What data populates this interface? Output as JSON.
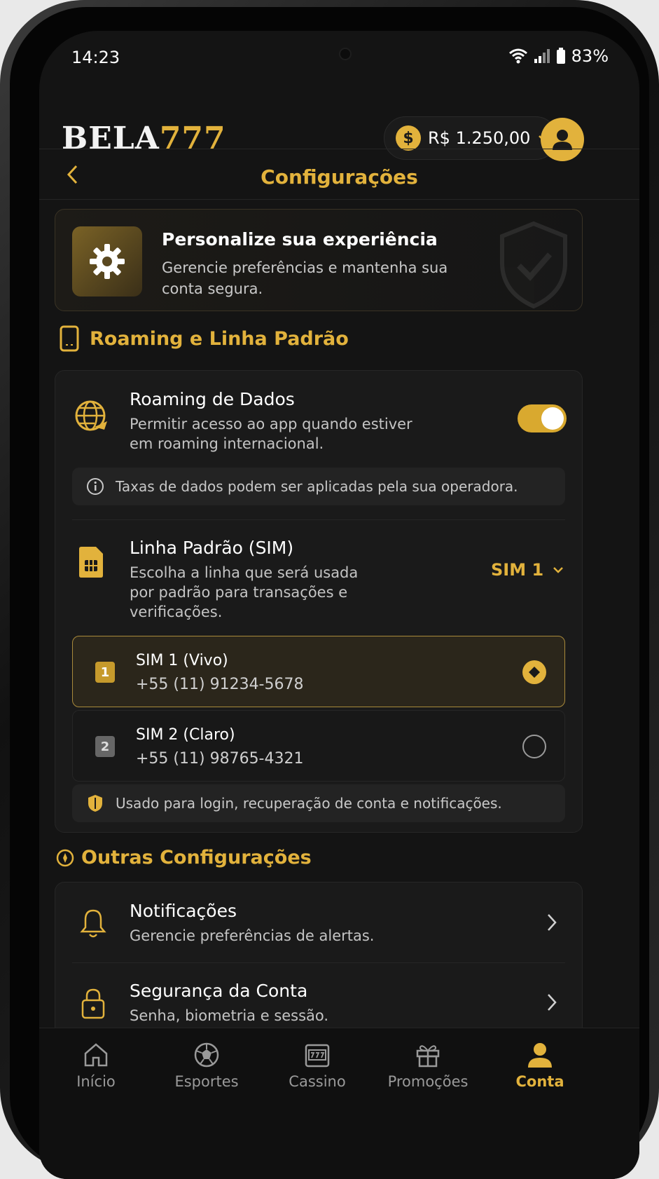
{
  "status_bar": {
    "time": "14:23",
    "battery": "83%"
  },
  "header": {
    "logo_white": "BELA",
    "logo_gold": "777",
    "balance": "R$ 1.250,00",
    "coin_symbol": "$"
  },
  "page": {
    "title": "Configurações"
  },
  "banner": {
    "title": "Personalize sua experiência",
    "description": "Gerencie preferências e mantenha sua conta segura."
  },
  "roaming_section": {
    "title": "Roaming e Linha Padrão",
    "roaming": {
      "title": "Roaming de Dados",
      "description": "Permitir acesso ao app quando estiver em roaming internacional.",
      "enabled": true
    },
    "roaming_note": "Taxas de dados podem ser aplicadas pela sua operadora.",
    "sim": {
      "title": "Linha Padrão (SIM)",
      "description": "Escolha a linha que será usada por padrão para transações e verificações.",
      "selected": "SIM 1"
    },
    "sim_options": [
      {
        "badge": "1",
        "name": "SIM 1 (Vivo)",
        "number": "+55 (11) 91234-5678",
        "selected": true
      },
      {
        "badge": "2",
        "name": "SIM 2 (Claro)",
        "number": "+55 (11) 98765-4321",
        "selected": false
      }
    ],
    "sim_note": "Usado para login, recuperação de conta e notificações."
  },
  "other_section": {
    "title": "Outras Configurações",
    "items": [
      {
        "title": "Notificações",
        "description": "Gerencie preferências de alertas.",
        "icon": "bell-icon"
      },
      {
        "title": "Segurança da Conta",
        "description": "Senha, biometria e sessão.",
        "icon": "lock-icon"
      }
    ]
  },
  "bottom_nav": [
    {
      "label": "Início",
      "icon": "home-icon",
      "active": false
    },
    {
      "label": "Esportes",
      "icon": "soccer-ball-icon",
      "active": false
    },
    {
      "label": "Cassino",
      "icon": "slot-machine-icon",
      "active": false
    },
    {
      "label": "Promoções",
      "icon": "gift-icon",
      "active": false
    },
    {
      "label": "Conta",
      "icon": "user-icon",
      "active": true
    }
  ],
  "colors": {
    "accent": "#e2b23c",
    "background": "#141414",
    "card": "#1a1a1a"
  }
}
